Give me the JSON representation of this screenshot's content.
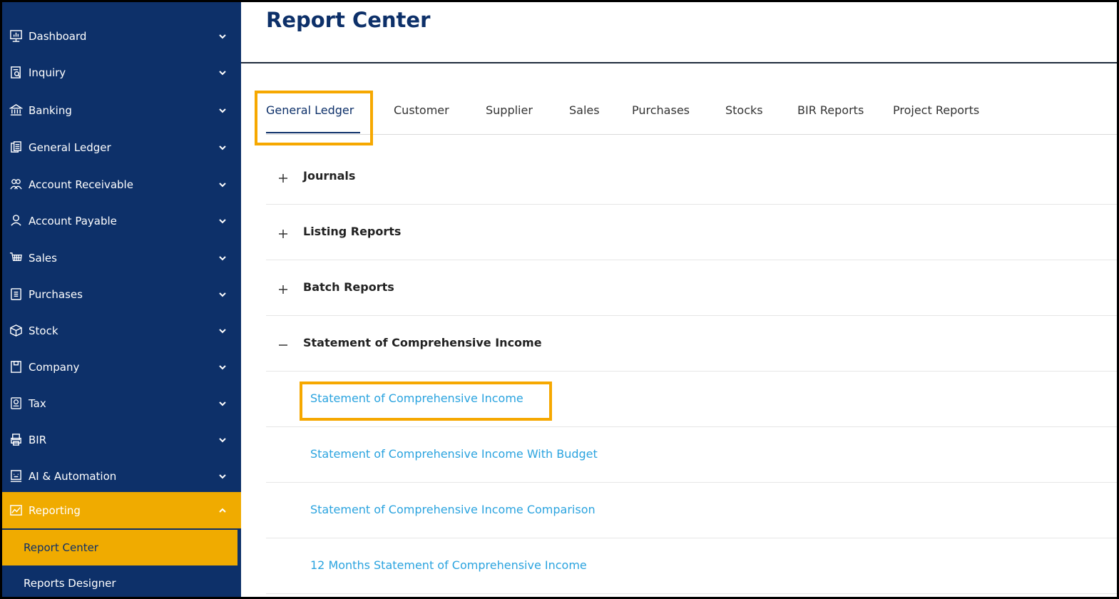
{
  "sidebar": {
    "items": [
      {
        "label": "Dashboard",
        "icon": "dashboard-icon"
      },
      {
        "label": "Inquiry",
        "icon": "inquiry-icon"
      },
      {
        "label": "Banking",
        "icon": "bank-icon"
      },
      {
        "label": "General Ledger",
        "icon": "ledger-icon"
      },
      {
        "label": "Account Receivable",
        "icon": "receivable-icon"
      },
      {
        "label": "Account Payable",
        "icon": "payable-icon"
      },
      {
        "label": "Sales",
        "icon": "cart-icon"
      },
      {
        "label": "Purchases",
        "icon": "purchases-icon"
      },
      {
        "label": "Stock",
        "icon": "box-icon"
      },
      {
        "label": "Company",
        "icon": "company-icon"
      },
      {
        "label": "Tax",
        "icon": "tax-icon"
      },
      {
        "label": "BIR",
        "icon": "bir-icon"
      },
      {
        "label": "AI & Automation",
        "icon": "ai-icon"
      },
      {
        "label": "Reporting",
        "icon": "chart-icon"
      }
    ],
    "subitems": [
      {
        "label": "Report Center"
      },
      {
        "label": "Reports Designer"
      }
    ]
  },
  "main": {
    "title": "Report Center",
    "tabs": [
      {
        "label": "General Ledger"
      },
      {
        "label": "Customer"
      },
      {
        "label": "Supplier"
      },
      {
        "label": "Sales"
      },
      {
        "label": "Purchases"
      },
      {
        "label": "Stocks"
      },
      {
        "label": "BIR Reports"
      },
      {
        "label": "Project Reports"
      }
    ],
    "sections": [
      {
        "title": "Journals"
      },
      {
        "title": "Listing Reports"
      },
      {
        "title": "Batch Reports"
      },
      {
        "title": "Statement of Comprehensive Income"
      }
    ],
    "reports": [
      {
        "label": "Statement of Comprehensive Income"
      },
      {
        "label": "Statement of Comprehensive Income With Budget"
      },
      {
        "label": "Statement of Comprehensive Income Comparison"
      },
      {
        "label": "12 Months Statement of Comprehensive Income"
      }
    ]
  },
  "colors": {
    "sidebar_bg": "#0d3069",
    "accent": "#f0ab00",
    "highlight": "#f6a800",
    "link": "#2aa3df",
    "title": "#0d3069"
  }
}
